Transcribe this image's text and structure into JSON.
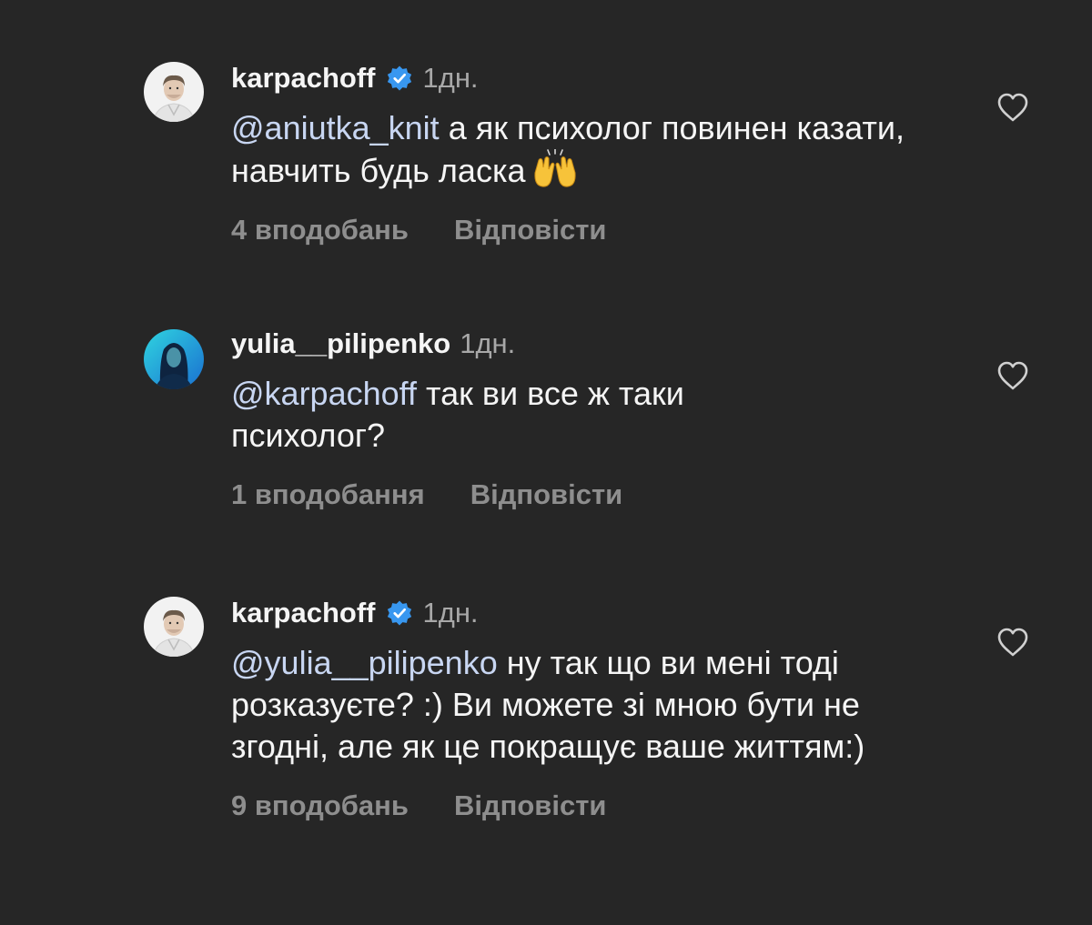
{
  "comments": [
    {
      "username": "karpachoff",
      "verified": true,
      "avatar_icon": "man-portrait-avatar",
      "time": "1дн.",
      "mention": "@aniutka_knit",
      "text": " а як психолог повинен казати, навчить будь ласка",
      "emoji": "raising-hands-emoji",
      "likes": "4 вподобань",
      "reply": "Відповісти"
    },
    {
      "username": "yulia__pilipenko",
      "verified": false,
      "avatar_icon": "woman-portrait-avatar",
      "time": "1дн.",
      "mention": "@karpachoff",
      "text": " так ви все ж таки психолог?",
      "likes": "1 вподобання",
      "reply": "Відповісти"
    },
    {
      "username": "karpachoff",
      "verified": true,
      "avatar_icon": "man-portrait-avatar",
      "time": "1дн.",
      "mention": "@yulia__pilipenko",
      "text": " ну так що ви мені тоді розказуєте? :) Ви можете зі мною бути не згодні, але як це покращує ваше життям:)",
      "likes": "9 вподобань",
      "reply": "Відповісти"
    }
  ],
  "colors": {
    "background": "#262626",
    "text": "#f5f5f5",
    "secondary": "#8e8e8e",
    "mention": "#c8d6f2",
    "verified": "#3897f0"
  }
}
